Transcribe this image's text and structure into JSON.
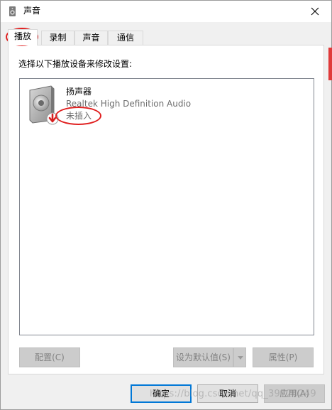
{
  "window": {
    "title": "声音",
    "icons": {
      "app": "speaker-app-icon",
      "close": "close-icon"
    }
  },
  "tabs": [
    {
      "label": "播放",
      "active": true
    },
    {
      "label": "录制",
      "active": false
    },
    {
      "label": "声音",
      "active": false
    },
    {
      "label": "通信",
      "active": false
    }
  ],
  "playback": {
    "instruction": "选择以下播放设备来修改设置:",
    "devices": [
      {
        "name": "扬声器",
        "description": "Realtek High Definition Audio",
        "status": "未插入",
        "icon": "speaker-unplugged-icon"
      }
    ],
    "buttons": {
      "configure": "配置(C)",
      "set_default": "设为默认值(S)",
      "properties": "属性(P)"
    }
  },
  "dialog_buttons": {
    "ok": "确定",
    "cancel": "取消",
    "apply": "应用(A)"
  },
  "watermark": "https://blog.csdn.net/qq_39720249",
  "colors": {
    "annotation": "#e02020",
    "focus_border": "#0078d7",
    "unplugged_badge": "#d61f1f"
  }
}
